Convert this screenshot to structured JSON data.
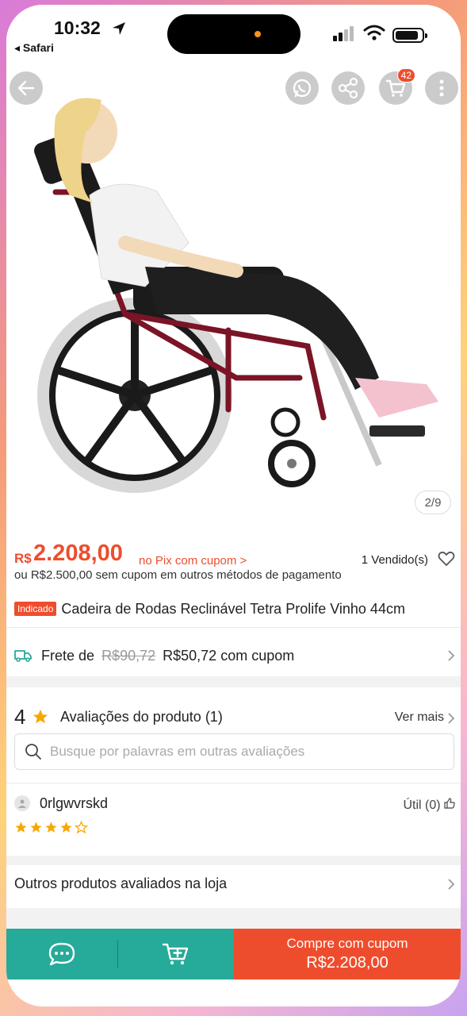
{
  "status_bar": {
    "time": "10:32",
    "back_app": "◂ Safari"
  },
  "header": {
    "cart_count": "42",
    "image_counter": "2/9"
  },
  "product": {
    "currency": "R$",
    "price": "2.208,00",
    "price_note": "no Pix com cupom >",
    "sold": "1 Vendido(s)",
    "alt_price": "ou R$2.500,00 sem cupom em outros métodos de pagamento",
    "badge": "Indicado",
    "title": "Cadeira de Rodas Reclinável Tetra Prolife Vinho 44cm",
    "image_alt": "wheelchair-product-photo"
  },
  "shipping": {
    "prefix": "Frete de",
    "old_price": "R$90,72",
    "new_price": "R$50,72 com cupom"
  },
  "reviews": {
    "score": "4",
    "title": "Avaliações do produto",
    "count": "(1)",
    "see_more": "Ver mais",
    "search_placeholder": "Busque por palavras em outras avaliações",
    "items": [
      {
        "user": "0rlgwvrskd",
        "useful": "Útil (0)",
        "rating": 4,
        "max": 5
      }
    ]
  },
  "other_products": "Outros produtos avaliados na loja",
  "bottom_bar": {
    "buy_line1": "Compre com cupom",
    "buy_line2": "R$2.208,00"
  },
  "colors": {
    "accent": "#ee4d2d",
    "teal": "#26aa99",
    "star": "#f6a700"
  }
}
